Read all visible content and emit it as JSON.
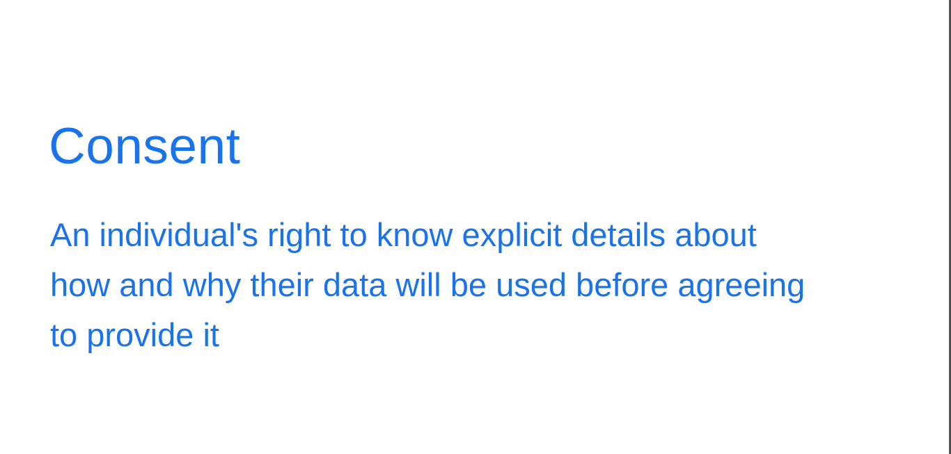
{
  "slide": {
    "title": "Consent",
    "definition_lines": [
      "An individual's right to know explicit details about",
      "how and why their data will be used before agreeing",
      "to provide it"
    ]
  },
  "colors": {
    "text_accent": "#1a73e8",
    "background": "#ffffff"
  }
}
